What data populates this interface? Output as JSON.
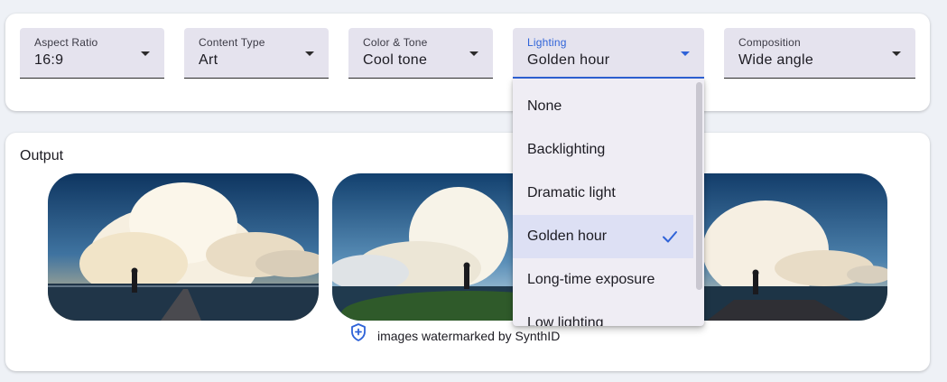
{
  "settings": {
    "aspect_ratio": {
      "label": "Aspect Ratio",
      "value": "16:9"
    },
    "content_type": {
      "label": "Content Type",
      "value": "Art"
    },
    "color_tone": {
      "label": "Color & Tone",
      "value": "Cool tone"
    },
    "lighting": {
      "label": "Lighting",
      "value": "Golden hour"
    },
    "composition": {
      "label": "Composition",
      "value": "Wide angle"
    }
  },
  "lighting_menu": {
    "options": [
      "None",
      "Backlighting",
      "Dramatic light",
      "Golden hour",
      "Long-time exposure",
      "Low lighting"
    ],
    "selected": "Golden hour"
  },
  "output": {
    "title": "Output",
    "watermark_text": "images watermarked by SynthID"
  },
  "icons": {
    "dropdown": "caret-down-icon",
    "check": "checkmark-icon",
    "watermark": "shield-plus-icon"
  },
  "colors": {
    "accent": "#2f63d8",
    "field_bg": "#e5e3ee",
    "selected_bg": "#dde0f4",
    "page_bg": "#eef1f6"
  }
}
